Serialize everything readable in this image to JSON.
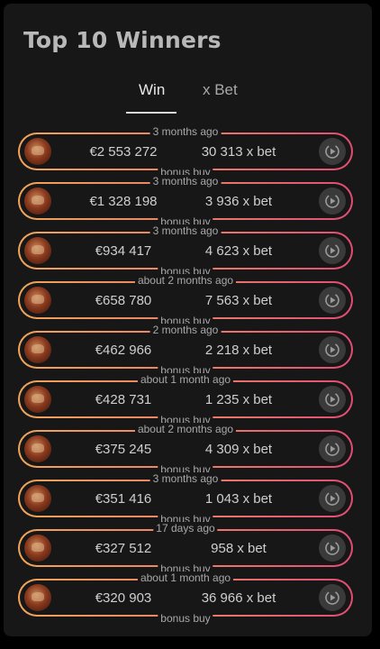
{
  "header": {
    "title": "Top 10 Winners"
  },
  "tabs": [
    {
      "label": "Win",
      "active": true
    },
    {
      "label": "x Bet",
      "active": false
    }
  ],
  "colors": {
    "accent_start": "#f0a55a",
    "accent_end": "#e24c74",
    "panel_bg": "#171717"
  },
  "winners": [
    {
      "time": "3 months ago",
      "amount": "€2 553 272",
      "x_bet": "30 313 x bet",
      "type": "bonus buy",
      "icon": "replay-icon"
    },
    {
      "time": "3 months ago",
      "amount": "€1 328 198",
      "x_bet": "3 936 x bet",
      "type": "bonus buy",
      "icon": "replay-icon"
    },
    {
      "time": "3 months ago",
      "amount": "€934 417",
      "x_bet": "4 623 x bet",
      "type": "bonus buy",
      "icon": "replay-icon"
    },
    {
      "time": "about 2 months ago",
      "amount": "€658 780",
      "x_bet": "7 563 x bet",
      "type": "bonus buy",
      "icon": "replay-icon"
    },
    {
      "time": "2 months ago",
      "amount": "€462 966",
      "x_bet": "2 218 x bet",
      "type": "bonus buy",
      "icon": "replay-icon"
    },
    {
      "time": "about 1 month ago",
      "amount": "€428 731",
      "x_bet": "1 235 x bet",
      "type": "bonus buy",
      "icon": "replay-icon"
    },
    {
      "time": "about 2 months ago",
      "amount": "€375 245",
      "x_bet": "4 309 x bet",
      "type": "bonus buy",
      "icon": "replay-icon"
    },
    {
      "time": "3 months ago",
      "amount": "€351 416",
      "x_bet": "1 043 x bet",
      "type": "bonus buy",
      "icon": "replay-icon"
    },
    {
      "time": "17 days ago",
      "amount": "€327 512",
      "x_bet": "958 x bet",
      "type": "bonus buy",
      "icon": "replay-icon"
    },
    {
      "time": "about 1 month ago",
      "amount": "€320 903",
      "x_bet": "36 966 x bet",
      "type": "bonus buy",
      "icon": "replay-icon"
    }
  ]
}
